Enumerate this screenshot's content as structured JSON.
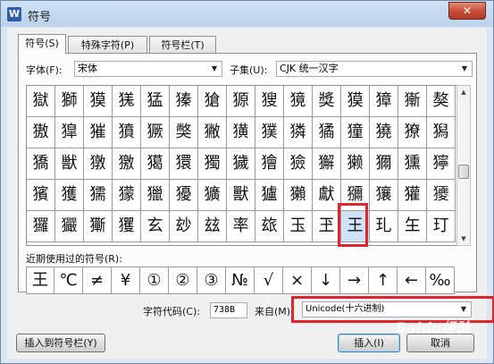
{
  "window": {
    "title": "符号",
    "close_label": "✕",
    "app_icon_label": "W"
  },
  "tabs": [
    {
      "label": "符号(S)"
    },
    {
      "label": "特殊字符(P)"
    },
    {
      "label": "符号栏(T)"
    }
  ],
  "font": {
    "label": "字体(F):",
    "value": "宋体"
  },
  "subset": {
    "label": "子集(U):",
    "value": "CJK 统一汉字"
  },
  "symbol_grid": [
    [
      "獄",
      "獅",
      "獏",
      "獇",
      "猛",
      "獉",
      "獊",
      "獂",
      "獀",
      "獍",
      "獎",
      "獏",
      "獐",
      "獑",
      "獒"
    ],
    [
      "獓",
      "獔",
      "獕",
      "獖",
      "獗",
      "獘",
      "獙",
      "獚",
      "獛",
      "獜",
      "獝",
      "獞",
      "獟",
      "獠",
      "獡"
    ],
    [
      "獢",
      "獣",
      "獤",
      "獥",
      "獦",
      "獧",
      "獨",
      "獩",
      "獪",
      "獫",
      "獬",
      "獭",
      "獮",
      "獯",
      "獰"
    ],
    [
      "獱",
      "獲",
      "獳",
      "獴",
      "獵",
      "獶",
      "獷",
      "獸",
      "獹",
      "獺",
      "獻",
      "獼",
      "獽",
      "獾",
      "獿"
    ],
    [
      "玀",
      "玁",
      "玂",
      "玃",
      "玄",
      "玅",
      "玆",
      "率",
      "玈",
      "玉",
      "玊",
      "王",
      "玌",
      "玍",
      "玎"
    ]
  ],
  "selected_symbol": "王",
  "recent": {
    "label": "近期使用过的符号(R):",
    "symbols": [
      "王",
      "℃",
      "≠",
      "¥",
      "①",
      "②",
      "③",
      "№",
      "√",
      "×",
      "↓",
      "→",
      "↑",
      "←",
      "‰"
    ]
  },
  "char_code": {
    "label": "字符代码(C):",
    "value": "738B"
  },
  "from": {
    "label": "来自(M)",
    "value": "Unicode(十六进制)"
  },
  "buttons": {
    "insert_to_bar": "插入到符号栏(Y)",
    "insert": "插入(I)",
    "cancel": "取消"
  },
  "watermark": "Baidu经验",
  "colors": {
    "highlight": "#e0262d",
    "selection": "#cfe3f7"
  }
}
